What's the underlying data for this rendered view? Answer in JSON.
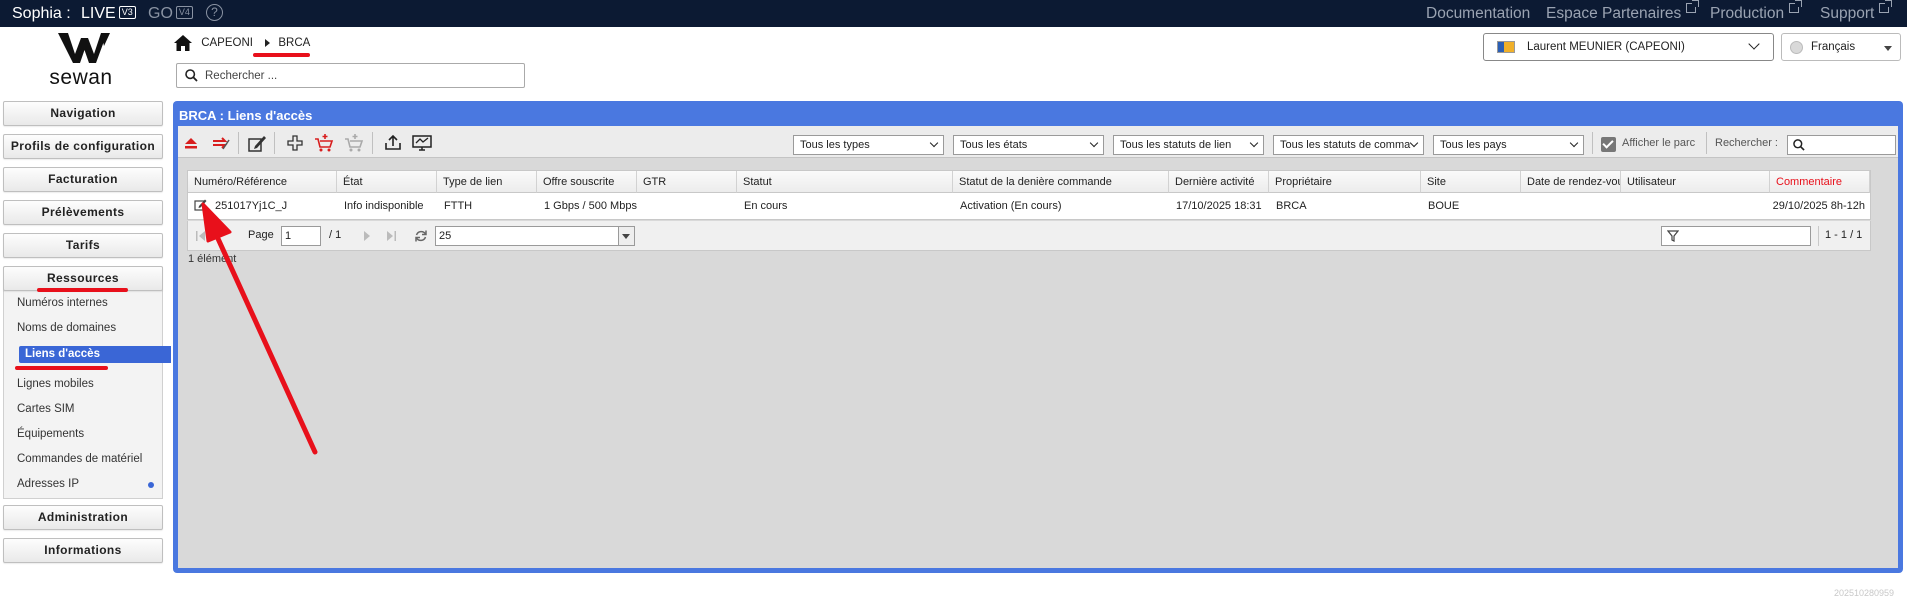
{
  "topbar": {
    "brand": "Sophia :",
    "live_label": "LIVE",
    "live_badge": "V3",
    "go_label": "GO",
    "go_badge": "V4",
    "help": "?",
    "links": [
      "Documentation",
      "Espace Partenaires",
      "Production",
      "Support"
    ]
  },
  "logo": {
    "text": "sewan"
  },
  "breadcrumb": {
    "items": [
      "CAPEONI",
      "BRCA"
    ]
  },
  "search": {
    "placeholder": "Rechercher ..."
  },
  "user": {
    "name": "Laurent MEUNIER (CAPEONI)"
  },
  "language": {
    "selected": "Français"
  },
  "sidebar": {
    "buttons": [
      "Navigation",
      "Profils de configuration",
      "Facturation",
      "Prélèvements",
      "Tarifs",
      "Ressources",
      "Administration",
      "Informations"
    ],
    "resources": [
      "Numéros internes",
      "Noms de domaines",
      "Liens d'accès",
      "Lignes mobiles",
      "Cartes SIM",
      "Équipements",
      "Commandes de matériel",
      "Adresses IP"
    ]
  },
  "panel": {
    "title": "BRCA : Liens d'accès",
    "filters": [
      "Tous les types",
      "Tous les états",
      "Tous les statuts de lien",
      "Tous les statuts de comma",
      "Tous les pays"
    ],
    "show_parc_label": "Afficher le parc",
    "show_parc_checked": true,
    "search_label": "Rechercher :"
  },
  "grid": {
    "columns": [
      "Numéro/Référence",
      "État",
      "Type de lien",
      "Offre souscrite",
      "GTR",
      "Statut",
      "Statut de la denière commande",
      "Dernière activité",
      "Propriétaire",
      "Site",
      "Date de rendez-vous",
      "Utilisateur",
      "Commentaire"
    ],
    "rows": [
      [
        "251017Yj1C_J",
        "Info indisponible",
        "FTTH",
        "1 Gbps / 500 Mbps",
        "",
        "En cours",
        "Activation (En cours)",
        "17/10/2025 18:31",
        "BRCA",
        "BOUE",
        "",
        "",
        "29/10/2025 8h-12h"
      ]
    ]
  },
  "pager": {
    "page_label": "Page",
    "page_value": "1",
    "of_label": "/ 1",
    "page_size": "25",
    "range": "1 - 1 / 1"
  },
  "footer": {
    "count": "1 élément"
  },
  "version": "202510280959",
  "colors": {
    "accent": "#4a78e0",
    "topbar": "#0c1a33",
    "annotation": "#e8101b",
    "comment_header": "#e8101b"
  }
}
